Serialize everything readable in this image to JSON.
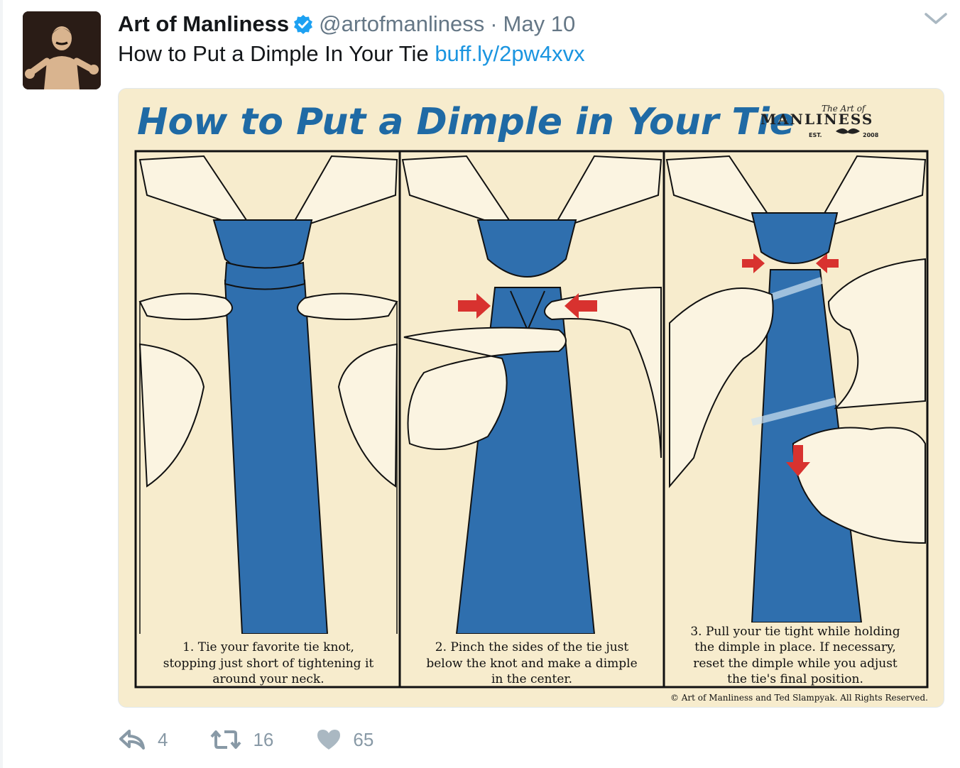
{
  "account": {
    "name": "Art of Manliness",
    "handle": "@artofmanliness",
    "separator": "·",
    "date": "May 10"
  },
  "tweet": {
    "text": "How to Put a Dimple In Your Tie",
    "link": "buff.ly/2pw4xvx"
  },
  "media": {
    "title": "How to Put a Dimple in Your Tie",
    "logo_small": "The Art of",
    "logo_main": "MANLINESS",
    "logo_est": "EST.",
    "logo_year": "2008",
    "panels": [
      {
        "lines": [
          "1. Tie your favorite tie knot,",
          "stopping just short of tightening it",
          "around your neck."
        ]
      },
      {
        "lines": [
          "2. Pinch the sides of the tie just",
          "below the knot and make a dimple",
          "in the center."
        ]
      },
      {
        "lines": [
          "3. Pull your tie tight while holding",
          "the dimple in place. If necessary,",
          "reset the dimple while you adjust",
          "the tie's final position."
        ]
      }
    ],
    "copyright": "© Art of Manliness and Ted Slampyak. All Rights Reserved.",
    "colors": {
      "background": "#f7eccd",
      "tie": "#2f6fae",
      "arrow": "#d8322f",
      "title": "#1f6aa5"
    }
  },
  "actions": {
    "reply_count": "4",
    "retweet_count": "16",
    "like_count": "65"
  },
  "icons": [
    "verified-badge-icon",
    "chevron-down-icon",
    "reply-icon",
    "retweet-icon",
    "heart-icon"
  ]
}
